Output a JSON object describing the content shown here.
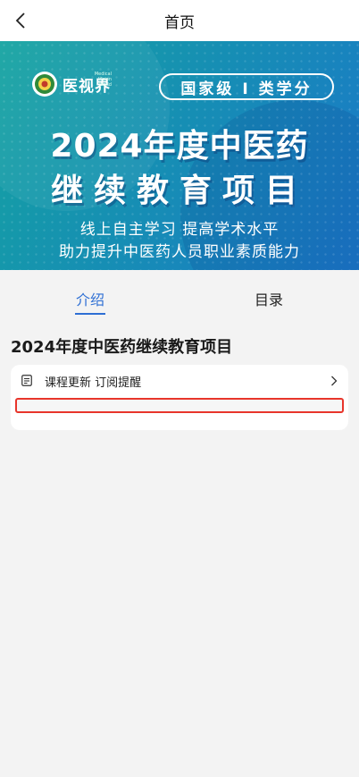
{
  "header": {
    "title": "首页"
  },
  "banner": {
    "logo_text": "医视界",
    "logo_sub": "Medical Vision World",
    "badge": "国家级 I 类学分",
    "title_line1": "2024年度中医药",
    "title_line2": "继续教育项目",
    "subtitle_line1": "线上自主学习 提高学术水平",
    "subtitle_line2": "助力提升中医药人员职业素质能力"
  },
  "tabs": [
    {
      "label": "介绍",
      "active": true
    },
    {
      "label": "目录",
      "active": false
    }
  ],
  "section": {
    "title": "2024年度中医药继续教育项目"
  },
  "card": {
    "subscribe_label": "课程更新 订阅提醒"
  },
  "colors": {
    "accent": "#2e6fd4",
    "highlight": "#e8352b",
    "banner_start": "#14a3a0",
    "banner_end": "#1b78c9"
  }
}
